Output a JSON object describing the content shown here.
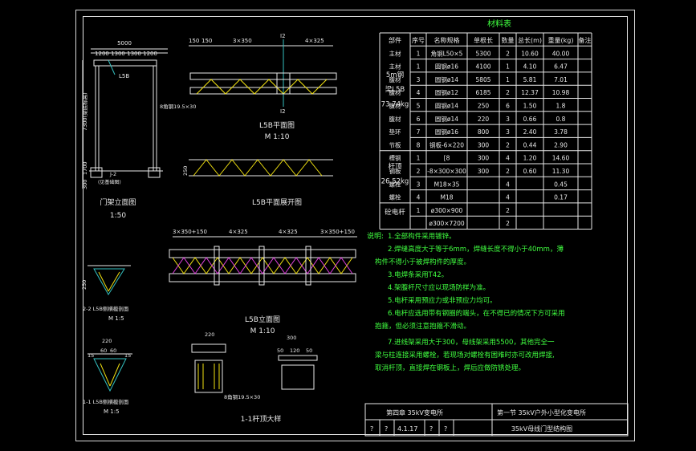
{
  "colors": {
    "background": "#000000",
    "frame": "#e8e8e8",
    "table": "#e8e8e8",
    "notes": "#40ff40",
    "title": "#40ff40",
    "dim": "#e8e8e8",
    "cyan": "#33c0c0",
    "yellow": "#f0e010",
    "magenta": "#e040e0"
  },
  "material_table": {
    "title": "材料表",
    "headers": [
      "部件",
      "序号",
      "名称规格",
      "单根长",
      "数量",
      "总长(m)",
      "重量(kg)",
      "备注"
    ],
    "group1": {
      "name_line1": "5m钢",
      "name_line2": "梁L5B",
      "name_line3": "73.74kg"
    },
    "group2": {
      "name_line1": "杆顶",
      "name_line2": "26.52kg"
    },
    "group3": {
      "name_line1": "砼电杆"
    },
    "rows": [
      [
        "主材",
        "1",
        "角钢L50×5",
        "5300",
        "2",
        "10.60",
        "40.00",
        ""
      ],
      [
        "主材",
        "1",
        "圆钢ø16",
        "4100",
        "1",
        "4.10",
        "6.47",
        ""
      ],
      [
        "腹材",
        "3",
        "圆钢ø14",
        "5805",
        "1",
        "5.81",
        "7.01",
        ""
      ],
      [
        "腹材",
        "4",
        "圆钢ø12",
        "6185",
        "2",
        "12.37",
        "10.98",
        ""
      ],
      [
        "腹材",
        "5",
        "圆钢ø14",
        "250",
        "6",
        "1.50",
        "1.8",
        ""
      ],
      [
        "腹材",
        "6",
        "圆钢ø14",
        "220",
        "3",
        "0.66",
        "0.8",
        ""
      ],
      [
        "垫环",
        "7",
        "圆钢ø16",
        "800",
        "3",
        "2.40",
        "3.78",
        ""
      ],
      [
        "节板",
        "8",
        "钢板-6×220",
        "300",
        "2",
        "0.44",
        "2.90",
        ""
      ],
      [
        "槽钢",
        "1",
        "[8",
        "300",
        "4",
        "1.20",
        "14.60",
        ""
      ],
      [
        "钢板",
        "2",
        "-8×300×300",
        "300",
        "2",
        "0.60",
        "11.30",
        ""
      ],
      [
        "螺栓",
        "3",
        "M18×35",
        "",
        "4",
        "",
        "0.45",
        ""
      ],
      [
        "螺栓",
        "4",
        "M18",
        "",
        "4",
        "",
        "0.17",
        ""
      ],
      [
        "",
        "1",
        "ø300×900",
        "",
        "2",
        "",
        "",
        ""
      ],
      [
        "",
        "",
        "ø300×7200",
        "",
        "2",
        "",
        "",
        ""
      ]
    ]
  },
  "notes": {
    "label": "说明:",
    "lines": [
      "1.全部构件采用镀锌。",
      "2.焊缝高度大于等于6mm，焊缝长度不得小于40mm，薄",
      "构件不得小于被焊构件的厚度。",
      "3.电焊条采用T42。",
      "4.架腹杆尺寸应以现场防样为准。",
      "5.电杆采用预应力或非预应力均可。",
      "6.电杆应选用带有钢圈的端头，在不得已的情况下方可采用",
      "抱箍，但必须注意抱箍不滑动。",
      "7.进线架采用大于300，母线架采用5500，其他完全一",
      "梁与柱连接采用螺栓，若现场对螺栓有困难时亦可改用焊接,",
      "取消杆顶，直接焊在钢板上，焊后应做防锈处理。"
    ]
  },
  "title_block": {
    "chapter": "第四章  35kV变电所",
    "section": "第一节  35kV户外小型化变电所",
    "q1": "?",
    "q2": "?",
    "code": "4.1.17",
    "q3": "?",
    "q4": "?",
    "drawing_name": "35kV母线门型结构图"
  },
  "drawings": {
    "gantry_title": "门架立面图",
    "gantry_scale": "1:50",
    "gantry_width": "5000",
    "gantry_spans": "1200 1300 1300 1200",
    "gantry_height": "7300(梁底标高)",
    "gantry_base": "1700",
    "gantry_base2": "300",
    "gantry_beam": "L5B",
    "gantry_j2": "J-2",
    "gantry_ground": "(见基础图)",
    "plan_title": "L5B平面图",
    "plan_scale": "M 1:10",
    "plan_dims": [
      "150",
      "150",
      "3×350",
      "4×325"
    ],
    "plan_section_mark": "I2",
    "plan_note": "8角钢19.5×30",
    "unfold_title": "L5B平面展开图",
    "elev_title": "L5B立面图",
    "elev_scale": "M 1:10",
    "elev_dims": [
      "3×350+150",
      "4×325",
      "4×325",
      "3×350+150"
    ],
    "sec22_title": "2-2 L5B侧横截剖面",
    "sec22_scale": "M 1:5",
    "sec11_title": "1-1 L5B侧横截剖面",
    "sec11_scale": "M 1:5",
    "sec11_dims": [
      "220",
      "60",
      "60",
      "15",
      "15"
    ],
    "top_title": "1-1杆顶大样",
    "top_dims": [
      "220",
      "300",
      "50",
      "120",
      "50"
    ],
    "top_note": "8角钢19.5×30",
    "labels_250": "250"
  }
}
